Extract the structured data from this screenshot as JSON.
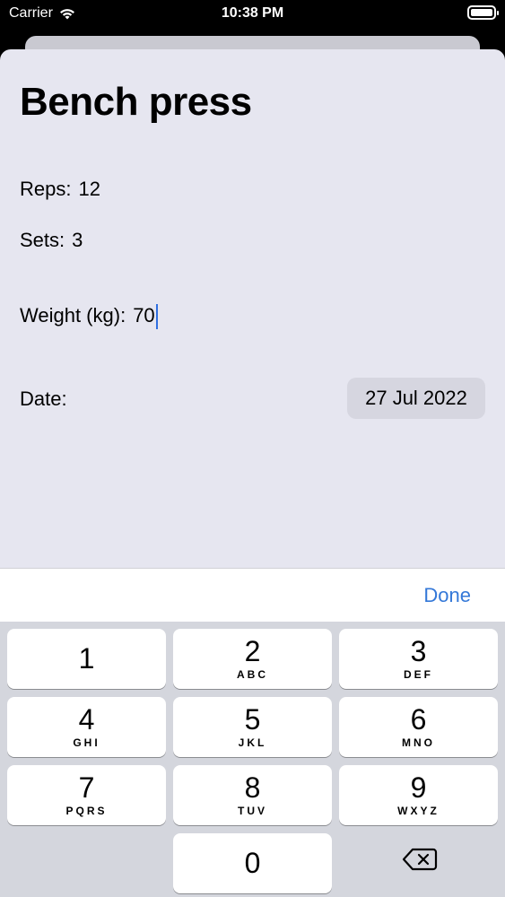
{
  "status": {
    "carrier": "Carrier",
    "time": "10:38 PM"
  },
  "form": {
    "title": "Bench press",
    "reps_label": "Reps:",
    "reps_value": "12",
    "sets_label": "Sets:",
    "sets_value": "3",
    "weight_label": "Weight (kg):",
    "weight_value": "70",
    "date_label": "Date:",
    "date_value": "27 Jul 2022"
  },
  "accessory": {
    "done_label": "Done"
  },
  "keypad": {
    "keys": [
      {
        "num": "1",
        "letters": ""
      },
      {
        "num": "2",
        "letters": "ABC"
      },
      {
        "num": "3",
        "letters": "DEF"
      },
      {
        "num": "4",
        "letters": "GHI"
      },
      {
        "num": "5",
        "letters": "JKL"
      },
      {
        "num": "6",
        "letters": "MNO"
      },
      {
        "num": "7",
        "letters": "PQRS"
      },
      {
        "num": "8",
        "letters": "TUV"
      },
      {
        "num": "9",
        "letters": "WXYZ"
      },
      {
        "num": "0",
        "letters": ""
      }
    ],
    "backspace_icon": "delete-left-icon"
  },
  "colors": {
    "accent": "#3478d8",
    "sheet_bg": "#e6e6f0",
    "keypad_bg": "#d4d6dd"
  }
}
